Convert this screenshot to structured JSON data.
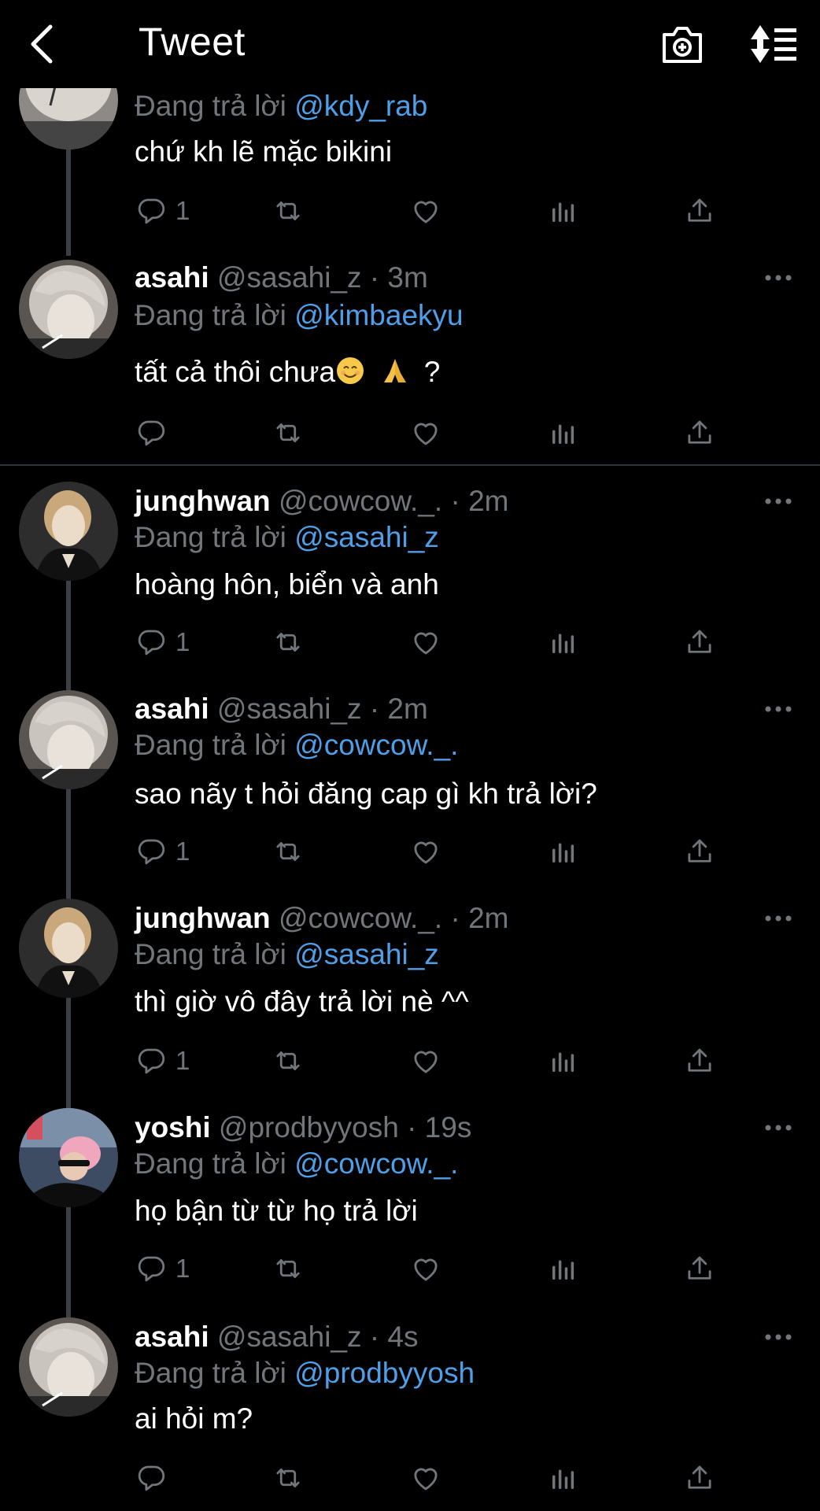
{
  "header": {
    "title": "Tweet"
  },
  "reply_prefix": "Đang trả lời",
  "tweets": [
    {
      "reply_to": "@kdy_rab",
      "text": "chứ kh lẽ mặc bikini",
      "reply_count": "1"
    },
    {
      "name": "asahi",
      "handle": "@sasahi_z",
      "sep": "·",
      "time": "3m",
      "reply_to": "@kimbaekyu",
      "text": "tất cả thôi chưa",
      "text_suffix": "?",
      "emojis": [
        "smiling-face",
        "folded-hands"
      ],
      "reply_count": ""
    },
    {
      "name": "junghwan",
      "handle": "@cowcow._.",
      "sep": "·",
      "time": "2m",
      "reply_to": "@sasahi_z",
      "text": "hoàng hôn, biển và anh",
      "reply_count": "1"
    },
    {
      "name": "asahi",
      "handle": "@sasahi_z",
      "sep": "·",
      "time": "2m",
      "reply_to": "@cowcow._.",
      "text": "sao nãy t hỏi đăng cap gì kh trả lời?",
      "reply_count": "1"
    },
    {
      "name": "junghwan",
      "handle": "@cowcow._.",
      "sep": "·",
      "time": "2m",
      "reply_to": "@sasahi_z",
      "text": "thì giờ vô đây trả lời nè ^^",
      "reply_count": "1"
    },
    {
      "name": "yoshi",
      "handle": "@prodbyyosh",
      "sep": "·",
      "time": "19s",
      "reply_to": "@cowcow._.",
      "text": "họ bận từ từ họ trả lời",
      "reply_count": "1"
    },
    {
      "name": "asahi",
      "handle": "@sasahi_z",
      "sep": "·",
      "time": "4s",
      "reply_to": "@prodbyyosh",
      "text": "ai hỏi m?",
      "reply_count": ""
    }
  ],
  "icons": [
    "back-arrow",
    "camera-plus",
    "sort-list",
    "reply",
    "retweet",
    "like",
    "analytics",
    "share",
    "more"
  ],
  "colors": {
    "background": "#000000",
    "link": "#4f9fe8",
    "muted": "#71767b",
    "text": "#ffffff",
    "thread_line": "#3b3f44"
  }
}
